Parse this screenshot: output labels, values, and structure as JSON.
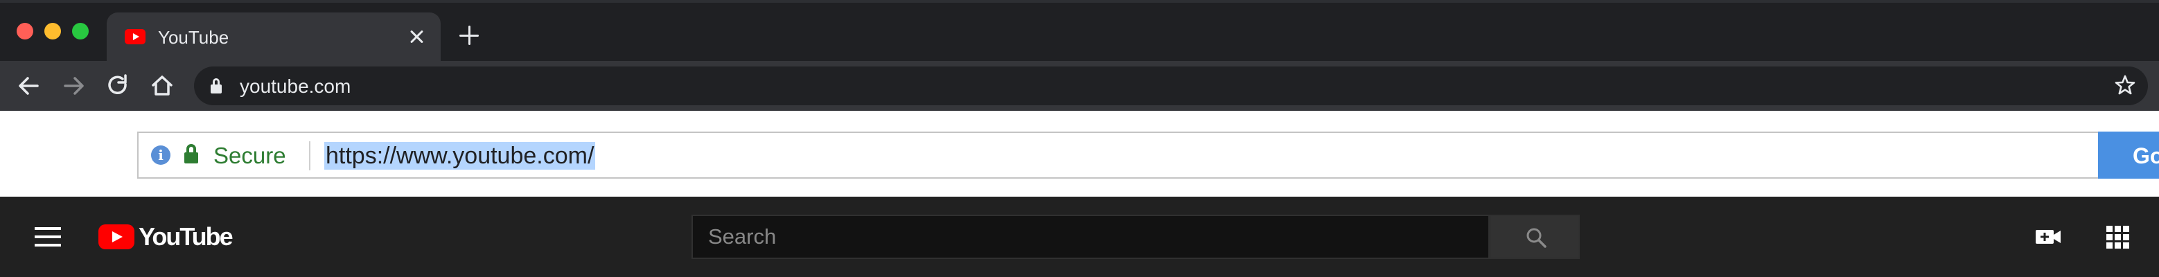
{
  "browser": {
    "tab": {
      "title": "YouTube"
    },
    "omnibox": {
      "url": "youtube.com"
    }
  },
  "page": {
    "security_label": "Secure",
    "url": "https://www.youtube.com/",
    "go_label": "Go"
  },
  "youtube": {
    "logo_text": "YouTube",
    "search": {
      "placeholder": "Search",
      "value": ""
    }
  },
  "colors": {
    "youtube_red": "#ff0000",
    "secure_green": "#2e7d32",
    "go_blue": "#4a90e2",
    "selection_blue": "#b4d5fe"
  },
  "icons": [
    "close-icon",
    "plus-icon",
    "back-arrow-icon",
    "forward-arrow-icon",
    "reload-icon",
    "home-icon",
    "lock-icon",
    "star-icon",
    "info-icon",
    "menu-icon",
    "youtube-play-icon",
    "search-icon",
    "video-camera-icon",
    "apps-grid-icon"
  ]
}
